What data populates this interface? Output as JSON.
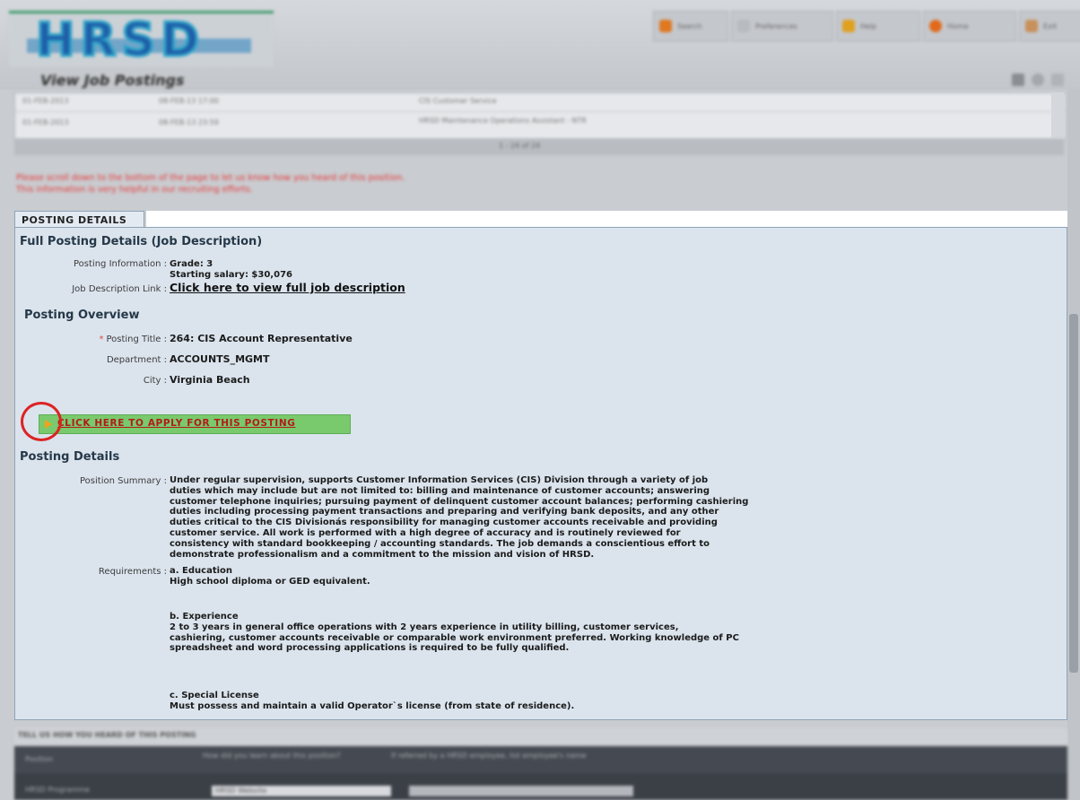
{
  "header": {
    "logo_text": "HRSD",
    "page_title": "View Job Postings",
    "toolbar": [
      {
        "label": "Search",
        "icon": "search-icon",
        "color": "#e07820"
      },
      {
        "label": "Preferences",
        "icon": "preferences-icon",
        "color": "#b8bcc0"
      },
      {
        "label": "Help",
        "icon": "help-icon",
        "color": "#e0a020"
      },
      {
        "label": "Home",
        "icon": "home-icon",
        "color": "#e06a1a"
      },
      {
        "label": "Exit",
        "icon": "exit-icon",
        "color": "#c8905a"
      }
    ]
  },
  "grid": {
    "rows": [
      {
        "date1": "01-FEB-2013",
        "date2": "08-FEB-13 17:00",
        "title": "CIS Customer Service"
      },
      {
        "date1": "01-FEB-2013",
        "date2": "08-FEB-13 23:59",
        "title": "HRSD Maintenance Operations Assistant - NTR"
      }
    ],
    "pager": "1 - 24 of 24"
  },
  "notice": {
    "line1": "Please scroll down to the bottom of the page to let us know how you heard of this position.",
    "line2": "This information is very helpful in our recruiting efforts."
  },
  "details": {
    "tab_label": "POSTING DETAILS",
    "full_title": "Full Posting Details (Job Description)",
    "posting_info_label": "Posting Information :",
    "grade": "Grade: 3",
    "salary": "Starting salary: $30,076",
    "job_link_label": "Job Description Link :",
    "job_link_text": "Click here to view full job description",
    "overview_title": "Posting Overview",
    "required_mark": "*",
    "posting_title_label": "Posting Title :",
    "posting_title_value": "264: CIS Account Representative",
    "department_label": "Department :",
    "department_value": "ACCOUNTS_MGMT",
    "city_label": "City :",
    "city_value": "Virginia Beach",
    "apply_label": "CLICK HERE TO APPLY FOR THIS POSTING",
    "posting_details_title": "Posting Details",
    "summary_label": "Position Summary :",
    "summary_lines": [
      "Under regular supervision, supports Customer Information Services (CIS) Division through a variety of job",
      "duties which may include but are not limited to: billing and maintenance of customer accounts; answering",
      "customer telephone inquiries; pursuing payment of delinquent customer account balances; performing cashiering",
      "duties including processing payment transactions and preparing and verifying bank deposits, and any other",
      "duties critical to the CIS Divisionás responsibility for managing customer accounts receivable and providing",
      "customer service. All work is performed with a high degree of accuracy and is routinely reviewed for",
      "consistency with standard bookkeeping / accounting standards. The job demands a conscientious effort to",
      "demonstrate professionalism and a commitment to the mission and vision of HRSD."
    ],
    "requirements_label": "Requirements :",
    "education_heading": "a. Education",
    "education_text": "High school diploma or GED equivalent.",
    "experience_heading": "b. Experience",
    "experience_lines": [
      "2 to 3 years in general office operations with 2 years experience in utility billing, customer services,",
      "cashiering, customer accounts receivable or comparable work environment preferred. Working knowledge of PC",
      "spreadsheet and word processing applications is required to be fully qualified."
    ],
    "license_heading": "c. Special License",
    "license_text": "Must possess and maintain a valid Operator`s license (from state of residence)."
  },
  "footer": {
    "bar_text": "TELL US HOW YOU HEARD OF THIS POSTING",
    "position_label": "Position",
    "position_hint": "How did you learn about this position?",
    "position_note": "If referred by a HRSD employee, list employee's name",
    "source_label": "HRSD Programme",
    "source_value": "HRSD Website"
  }
}
